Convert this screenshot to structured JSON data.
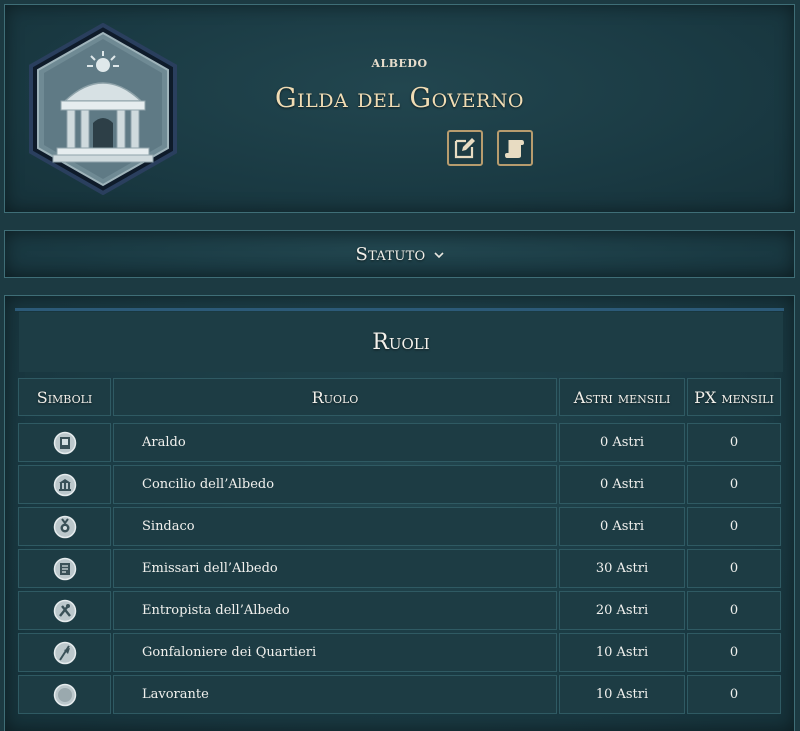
{
  "header": {
    "subtitle": "ALBEDO",
    "title": "Gilda del Governo"
  },
  "statuto": {
    "label": "Statuto"
  },
  "roles": {
    "title": "Ruoli",
    "columns": [
      "Simboli",
      "Ruolo",
      "Astri mensili",
      "PX mensili"
    ],
    "rows": [
      {
        "icon": "herald-icon",
        "name": "Araldo",
        "astri": "0 Astri",
        "px": "0"
      },
      {
        "icon": "council-temple-icon",
        "name": "Concilio dell’Albedo",
        "astri": "0 Astri",
        "px": "0"
      },
      {
        "icon": "mayor-medal-icon",
        "name": "Sindaco",
        "astri": "0 Astri",
        "px": "0"
      },
      {
        "icon": "emissary-icon",
        "name": "Emissari dell’Albedo",
        "astri": "30 Astri",
        "px": "0"
      },
      {
        "icon": "entropist-icon",
        "name": "Entropista dell’Albedo",
        "astri": "20 Astri",
        "px": "0"
      },
      {
        "icon": "gonfalon-icon",
        "name": "Gonfaloniere dei Quartieri",
        "astri": "10 Astri",
        "px": "0"
      },
      {
        "icon": "worker-blank-icon",
        "name": "Lavorante",
        "astri": "10 Astri",
        "px": "0"
      }
    ]
  },
  "colors": {
    "background": "#1c3a42",
    "title_gold": "#f0dcb4",
    "button_border": "#b79c6e",
    "button_icon": "#e8dcc2"
  }
}
